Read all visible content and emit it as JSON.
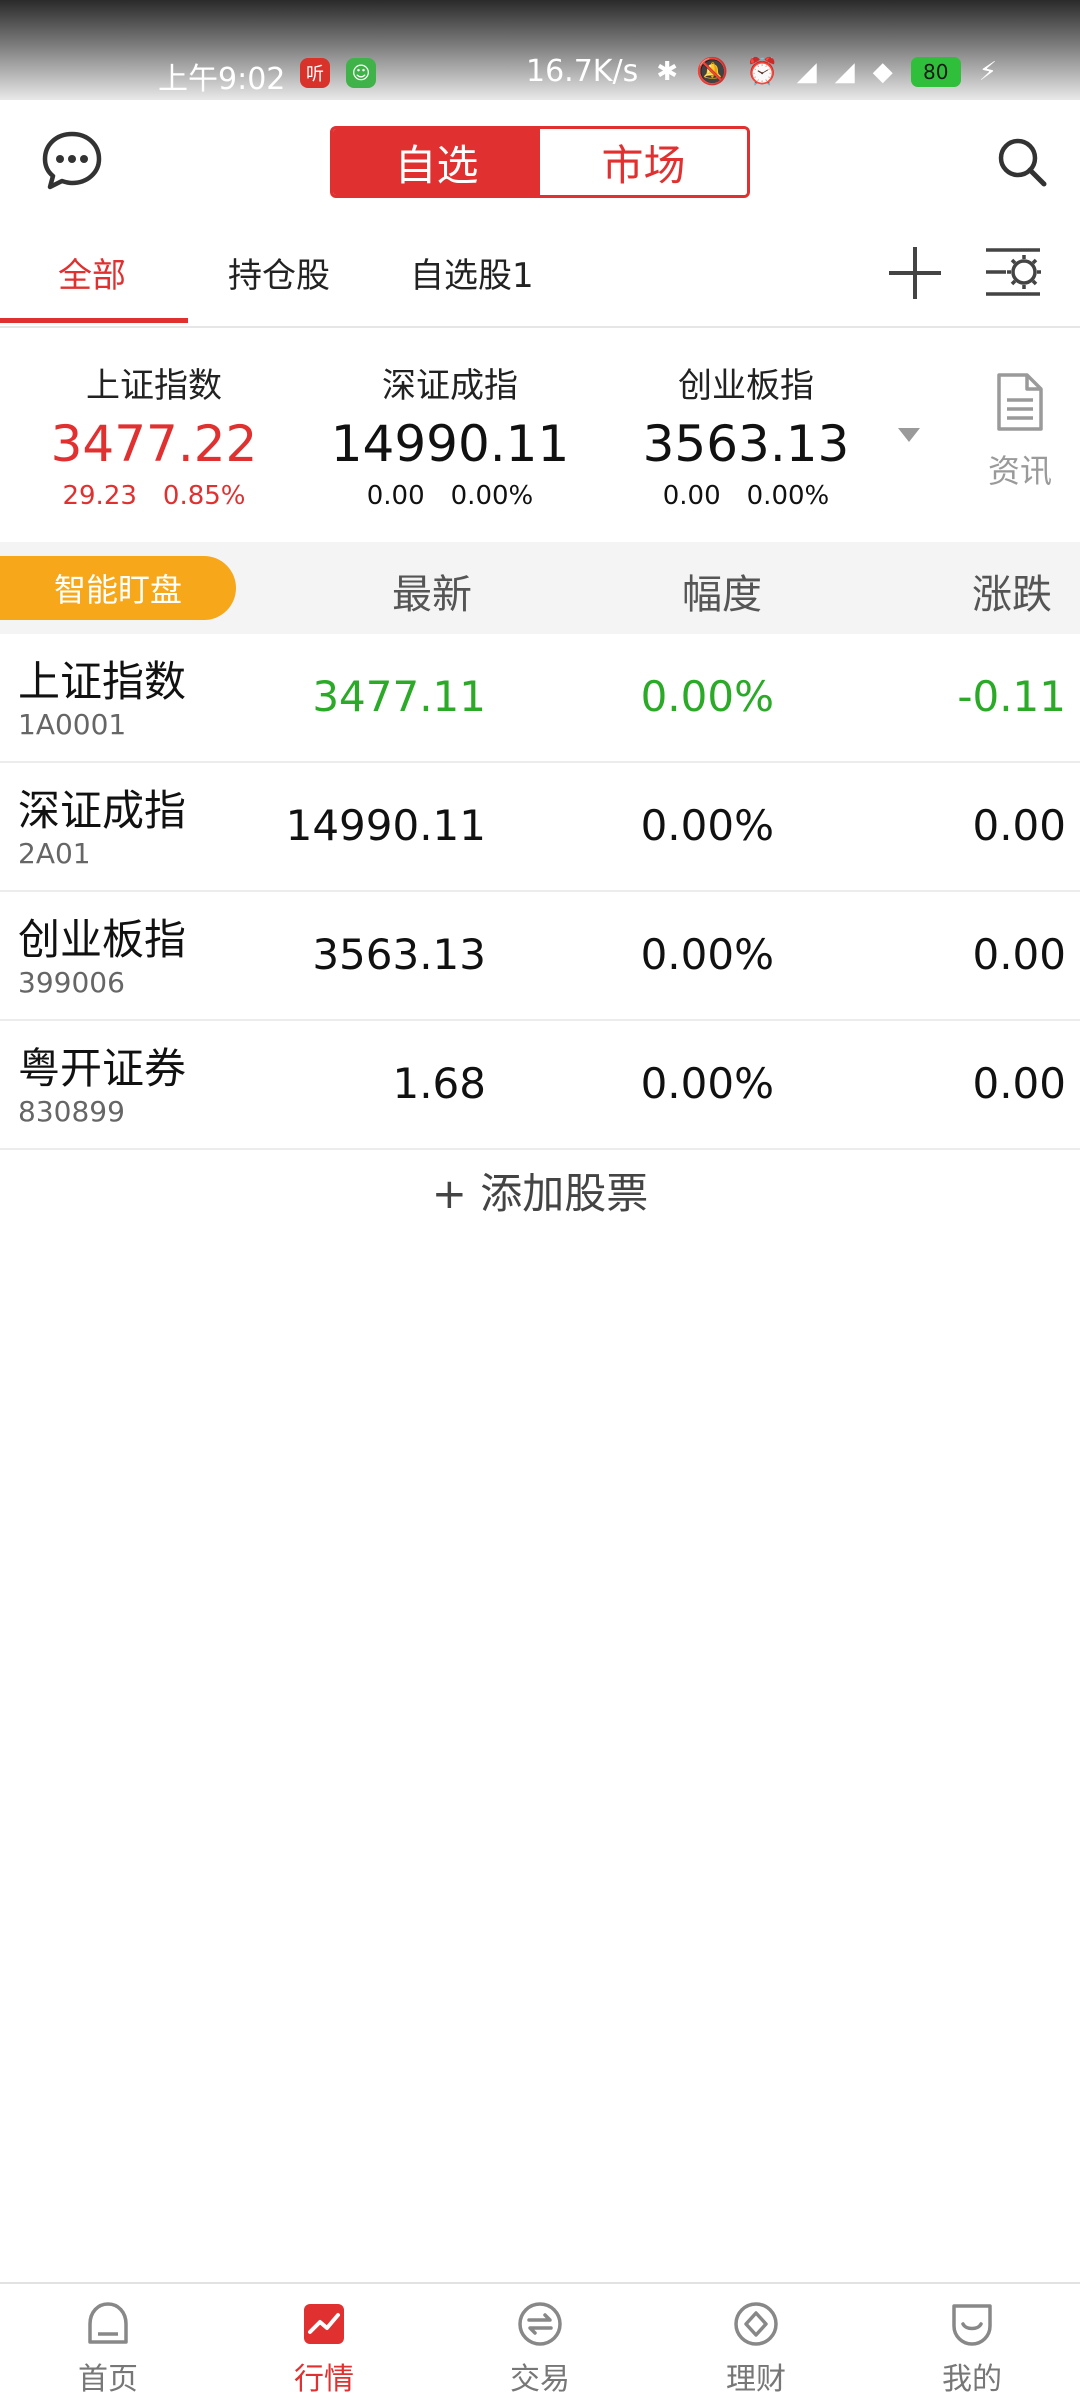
{
  "status_bar": {
    "time": "上午9:02",
    "badge1": "听",
    "badge2": "☺",
    "net_speed": "16.7K/s",
    "battery": "80"
  },
  "header": {
    "segments": [
      "自选",
      "市场"
    ],
    "active_segment": "自选",
    "accent_color": "#e03030"
  },
  "tabs": {
    "items": [
      "全部",
      "持仓股",
      "自选股1"
    ],
    "active": "全部"
  },
  "indices": [
    {
      "name": "上证指数",
      "value": "3477.22",
      "change": "29.23",
      "pct": "0.85%"
    },
    {
      "name": "深证成指",
      "value": "14990.11",
      "change": "0.00",
      "pct": "0.00%"
    },
    {
      "name": "创业板指",
      "value": "3563.13",
      "change": "0.00",
      "pct": "0.00%"
    }
  ],
  "news_label": "资讯",
  "table": {
    "smart_button": "智能盯盘",
    "columns": [
      "最新",
      "幅度",
      "涨跌"
    ],
    "rows": [
      {
        "name": "上证指数",
        "code": "1A0001",
        "price": "3477.11",
        "pct": "0.00%",
        "change": "-0.11"
      },
      {
        "name": "深证成指",
        "code": "2A01",
        "price": "14990.11",
        "pct": "0.00%",
        "change": "0.00"
      },
      {
        "name": "创业板指",
        "code": "399006",
        "price": "3563.13",
        "pct": "0.00%",
        "change": "0.00"
      },
      {
        "name": "粤开证券",
        "code": "830899",
        "price": "1.68",
        "pct": "0.00%",
        "change": "0.00"
      }
    ]
  },
  "add_stock": "+ 添加股票",
  "bottom_nav": {
    "items": [
      "首页",
      "行情",
      "交易",
      "理财",
      "我的"
    ],
    "active": "行情"
  }
}
